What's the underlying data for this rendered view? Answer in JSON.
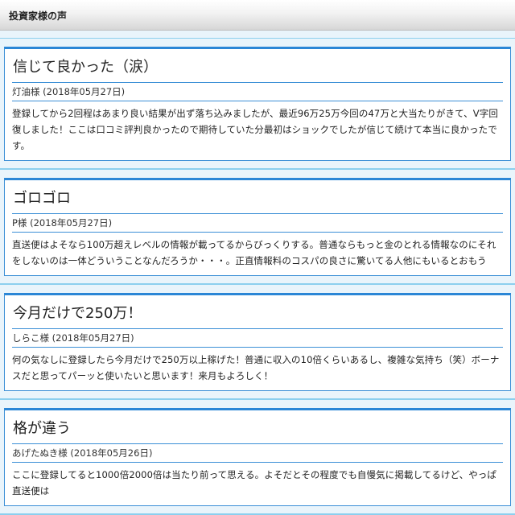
{
  "header": {
    "title": "投資家様の声"
  },
  "reviews": [
    {
      "title": "信じて良かった（涙）",
      "author": "灯油様 (2018年05月27日)",
      "body": "登録してから2回程はあまり良い結果が出ず落ち込みましたが、最近96万25万今回の47万と大当たりがきて、V字回復しました！ここは口コミ評判良かったので期待していた分最初はショックでしたが信じて続けて本当に良かったです。"
    },
    {
      "title": "ゴロゴロ",
      "author": "P様 (2018年05月27日)",
      "body": "直送便はよそなら100万超えレベルの情報が載ってるからびっくりする。普通ならもっと金のとれる情報なのにそれをしないのは一体どういうことなんだろうか・・・。正直情報料のコスパの良さに驚いてる人他にもいるとおもう"
    },
    {
      "title": "今月だけで250万！",
      "author": "しらこ様 (2018年05月27日)",
      "body": "何の気なしに登録したら今月だけで250万以上稼げた！普通に収入の10倍くらいあるし、複雑な気持ち（笑）ボーナスだと思ってパーッと使いたいと思います！来月もよろしく！"
    },
    {
      "title": "格が違う",
      "author": "あげたぬき様 (2018年05月26日)",
      "body": "ここに登録してると1000倍2000倍は当たり前って思える。よそだとその程度でも自慢気に掲載してるけど、やっぱ直送便は"
    }
  ]
}
